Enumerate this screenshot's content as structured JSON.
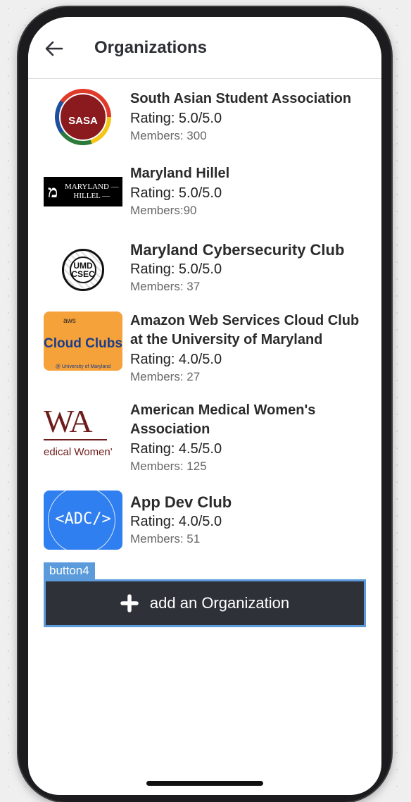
{
  "header": {
    "back_icon": "arrow-left-icon",
    "title": "Organizations"
  },
  "organizations": [
    {
      "name": "South Asian Student Association",
      "rating": "Rating: 5.0/5.0",
      "members": "Members: 300",
      "logo_text": "SASA"
    },
    {
      "name": "Maryland Hillel",
      "rating": "Rating: 5.0/5.0",
      "members": "Members:90",
      "logo_text": "MARYLAND — HILLEL —"
    },
    {
      "name": "Maryland Cybersecurity Club",
      "rating": "Rating: 5.0/5.0",
      "members": "Members: 37",
      "logo_text": "UMD CSEC"
    },
    {
      "name": "Amazon Web Services Cloud Club at the University of Maryland",
      "rating": "Rating: 4.0/5.0",
      "members": "Members: 27",
      "logo_text": "Cloud Clubs",
      "logo_small": "aws",
      "logo_foot": "@ University of Maryland"
    },
    {
      "name": "American Medical Women's Association",
      "rating": "Rating: 4.5/5.0",
      "members": "Members: 125",
      "logo_text": "WA",
      "logo_sub": "edical Women'"
    },
    {
      "name": "App Dev Club",
      "rating": "Rating: 4.0/5.0",
      "members": "Members: 51",
      "logo_text": "<ADC/>"
    }
  ],
  "add_button": {
    "tag": "button4",
    "label": "add an Organization",
    "icon": "plus-icon"
  },
  "colors": {
    "button_bg": "#2e3138",
    "button_border": "#5b9bdc",
    "title": "#2e3036"
  }
}
